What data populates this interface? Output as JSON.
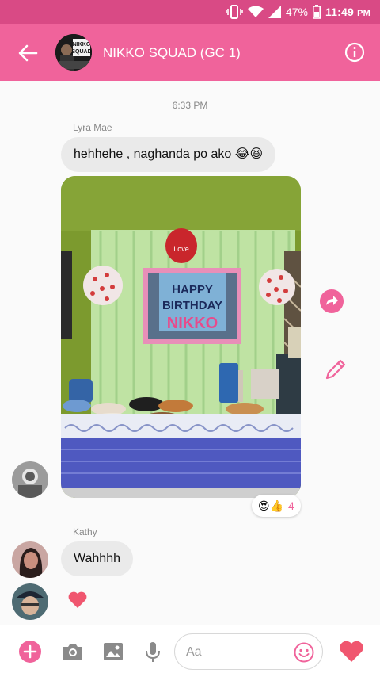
{
  "status_bar": {
    "battery": "47%",
    "time": "11:49",
    "time_suffix": "PM"
  },
  "header": {
    "title": "NIKKO SQUAD (GC 1)",
    "avatar_text_line1": "NIKKO",
    "avatar_text_line2": "SQUAD"
  },
  "chat": {
    "timestamp": "6:33 PM",
    "messages": [
      {
        "sender": "Lyra Mae",
        "text": "hehhehe , naghanda po ako 😂😆"
      },
      {
        "type": "photo",
        "banner_line1": "HAPPY",
        "banner_line2": "BIRTHDAY",
        "banner_line3": "NIKKO",
        "balloon_text": "Love"
      },
      {
        "sender": "Kathy",
        "text": "Wahhhh"
      }
    ],
    "reaction": {
      "emojis": "😍👍",
      "count": "4"
    }
  },
  "composer": {
    "placeholder": "Aa"
  },
  "colors": {
    "brand": "#f0639b",
    "status_bar": "#d94a85",
    "bubble": "#eaeaea"
  }
}
